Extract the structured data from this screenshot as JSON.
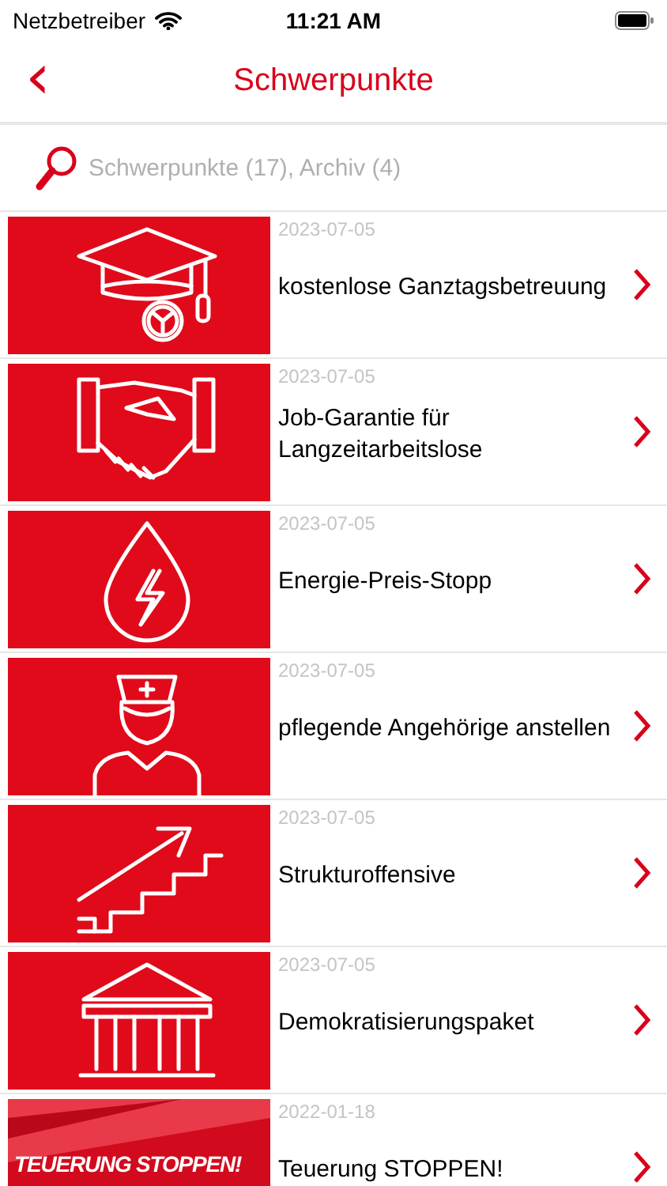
{
  "status_bar": {
    "carrier": "Netzbetreiber",
    "time": "11:21 AM"
  },
  "nav": {
    "back": "‹",
    "title": "Schwerpunkte"
  },
  "search": {
    "placeholder": "Schwerpunkte (17), Archiv (4)"
  },
  "items": [
    {
      "kind": "graduation",
      "date": "2023-07-05",
      "title": "kostenlose Ganztagsbetreuung"
    },
    {
      "kind": "handshake",
      "date": "2023-07-05",
      "title": "Job-Garantie für Langzeitarbeitslose"
    },
    {
      "kind": "drop",
      "date": "2023-07-05",
      "title": "Energie-Preis-Stopp"
    },
    {
      "kind": "nurse",
      "date": "2023-07-05",
      "title": "pflegende Angehörige anstellen"
    },
    {
      "kind": "stairs",
      "date": "2023-07-05",
      "title": "Strukturoffensive"
    },
    {
      "kind": "building",
      "date": "2023-07-05",
      "title": "Demokratisierungspaket"
    },
    {
      "kind": "banner",
      "banner_text": "TEUERUNG STOPPEN!",
      "date": "2022-01-18",
      "title": "Teuerung STOPPEN!"
    }
  ]
}
